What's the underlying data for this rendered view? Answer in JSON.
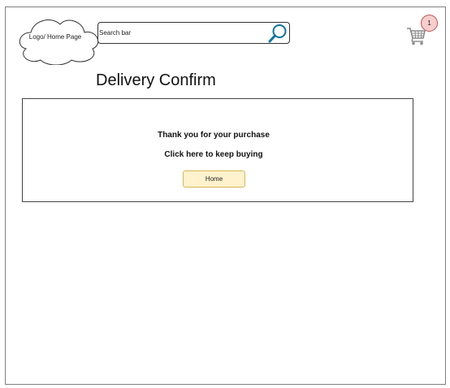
{
  "header": {
    "logo_label": "Logo/ Home Page",
    "search": {
      "placeholder": "Search bar",
      "icon": "search-icon"
    },
    "cart": {
      "icon": "shopping-cart-icon",
      "badge_count": "1"
    }
  },
  "main": {
    "title": "Delivery Confirm",
    "message": "Thank you for your purchase",
    "keep_buying_text": "Click here to keep buying",
    "home_button_label": "Home"
  },
  "colors": {
    "badge_fill": "#f8cecc",
    "badge_border": "#b85450",
    "button_fill": "#fff2cc",
    "button_border": "#d6b656",
    "search_icon": "#10739e"
  }
}
